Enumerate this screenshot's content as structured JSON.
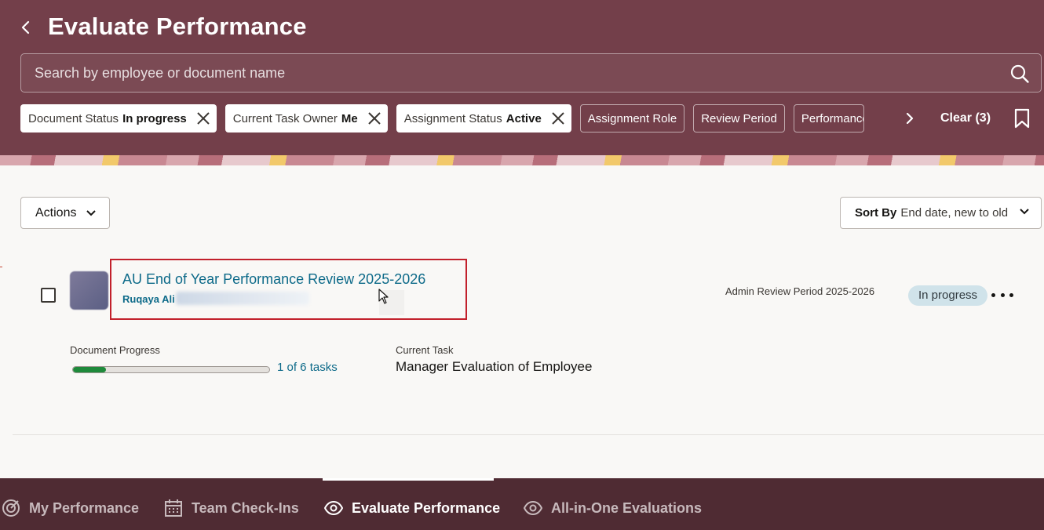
{
  "header": {
    "title": "Evaluate Performance",
    "search_placeholder": "Search by employee or document name"
  },
  "filters": {
    "applied": [
      {
        "label": "Document Status",
        "value": "In progress"
      },
      {
        "label": "Current Task Owner",
        "value": "Me"
      },
      {
        "label": "Assignment Status",
        "value": "Active"
      }
    ],
    "options": [
      "Assignment Role",
      "Review Period",
      "Performance"
    ],
    "clear_label": "Clear (3)"
  },
  "toolbar": {
    "actions_label": "Actions",
    "sort_key": "Sort By",
    "sort_value": "End date, new to old"
  },
  "document": {
    "title": "AU End of Year Performance Review 2025-2026",
    "employee_name": "Ruqaya Ali",
    "review_period": "Admin Review Period 2025-2026",
    "status": "In progress",
    "progress_label": "Document Progress",
    "progress_fraction": 0.1667,
    "tasks_text": "1 of 6 tasks",
    "current_task_label": "Current Task",
    "current_task": "Manager Evaluation of Employee"
  },
  "bottom_nav": {
    "items": [
      {
        "label": "My Performance",
        "icon": "target-icon"
      },
      {
        "label": "Team Check-Ins",
        "icon": "calendar-icon"
      },
      {
        "label": "Evaluate Performance",
        "icon": "eye-icon",
        "active": true
      },
      {
        "label": "All-in-One Evaluations",
        "icon": "eye-icon"
      }
    ]
  },
  "colors": {
    "header_bg": "#733f4a",
    "nav_bg": "#4f2b33",
    "link": "#0d6a89",
    "progress": "#1f8a3b",
    "highlight_border": "#c2202b",
    "status_badge_bg": "#d0e3ea"
  }
}
